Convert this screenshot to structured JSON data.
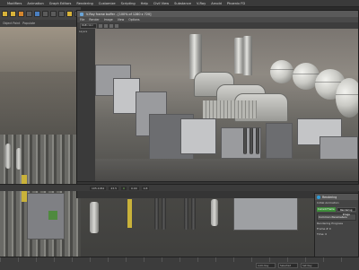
{
  "host": {
    "menu": [
      "",
      "Modifiers",
      "Animation",
      "Graph Editors",
      "Rendering",
      "Customize",
      "Scripting",
      "Help",
      "Civil View",
      "Substance",
      "V-Ray",
      "Arnold",
      "Phoenix FD"
    ],
    "command_tabs": [
      "Object Paint",
      "Populate"
    ]
  },
  "renderer": {
    "title": "V-Ray frame buffer - [100% of 1280 x 720]",
    "menu": [
      "File",
      "Render",
      "Image",
      "View",
      "Options"
    ],
    "channel": "RGB color",
    "layers_label": "Layers",
    "status_left": "0, 0",
    "status_values": [
      "[0.000, 0.000, 0.000]",
      "HSV"
    ]
  },
  "timeline": {
    "frames": [
      "0",
      "10",
      "20",
      "30"
    ],
    "values": [
      "105.1052",
      "23.5",
      "0",
      "0.00",
      "0.8"
    ]
  },
  "panel": {
    "title": "Rendering",
    "row1": "Initial Animation",
    "field": "Rendering Image",
    "buttons": [
      "Current Frame",
      "Rendering Image"
    ],
    "group": "Common Parameters",
    "rows": [
      "Rendering Progress",
      "Frame # 0",
      "Time: 0"
    ]
  },
  "bottom": {
    "ctrl_left": "Auto Key",
    "ctrl_mid": "Selected",
    "ctrl_right": "Set Key"
  }
}
